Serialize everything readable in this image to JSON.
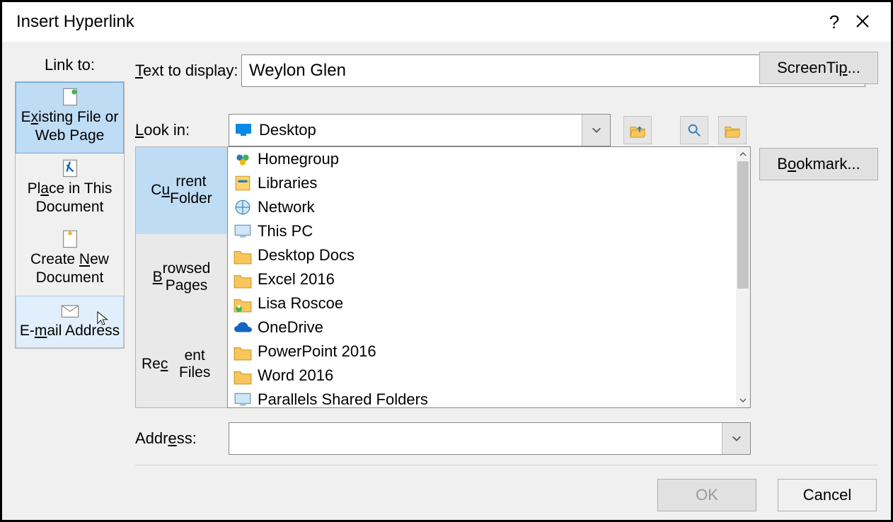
{
  "title": "Insert Hyperlink",
  "linkto_header": "Link to:",
  "linkto_items": [
    {
      "label_lines": [
        "Existing File or",
        "Web Page"
      ],
      "accel": "x"
    },
    {
      "label_lines": [
        "Place in This",
        "Document"
      ],
      "accel": "A"
    },
    {
      "label_lines": [
        "Create New",
        "Document"
      ],
      "accel": "N"
    },
    {
      "label_lines": [
        "E-mail Address"
      ],
      "accel": "m"
    }
  ],
  "text_to_display_label": "Text to display:",
  "text_to_display_value": "Weylon Glen",
  "screentip_label": "ScreenTip...",
  "bookmark_label": "Bookmark...",
  "lookin_label": "Look in:",
  "lookin_value": "Desktop",
  "tabs": [
    "Current Folder",
    "Browsed Pages",
    "Recent Files"
  ],
  "tabs_accel": [
    "U",
    "B",
    "C"
  ],
  "files": [
    {
      "name": "Homegroup",
      "icon": "homegroup"
    },
    {
      "name": "Libraries",
      "icon": "libraries"
    },
    {
      "name": "Network",
      "icon": "network"
    },
    {
      "name": "This PC",
      "icon": "pc"
    },
    {
      "name": "Desktop Docs",
      "icon": "folder"
    },
    {
      "name": "Excel 2016",
      "icon": "folder"
    },
    {
      "name": "Lisa Roscoe",
      "icon": "user"
    },
    {
      "name": "OneDrive",
      "icon": "onedrive"
    },
    {
      "name": "PowerPoint 2016",
      "icon": "folder"
    },
    {
      "name": "Word 2016",
      "icon": "folder"
    },
    {
      "name": "Parallels Shared Folders",
      "icon": "pc"
    }
  ],
  "address_label": "Address:",
  "address_value": "",
  "ok_label": "OK",
  "cancel_label": "Cancel"
}
